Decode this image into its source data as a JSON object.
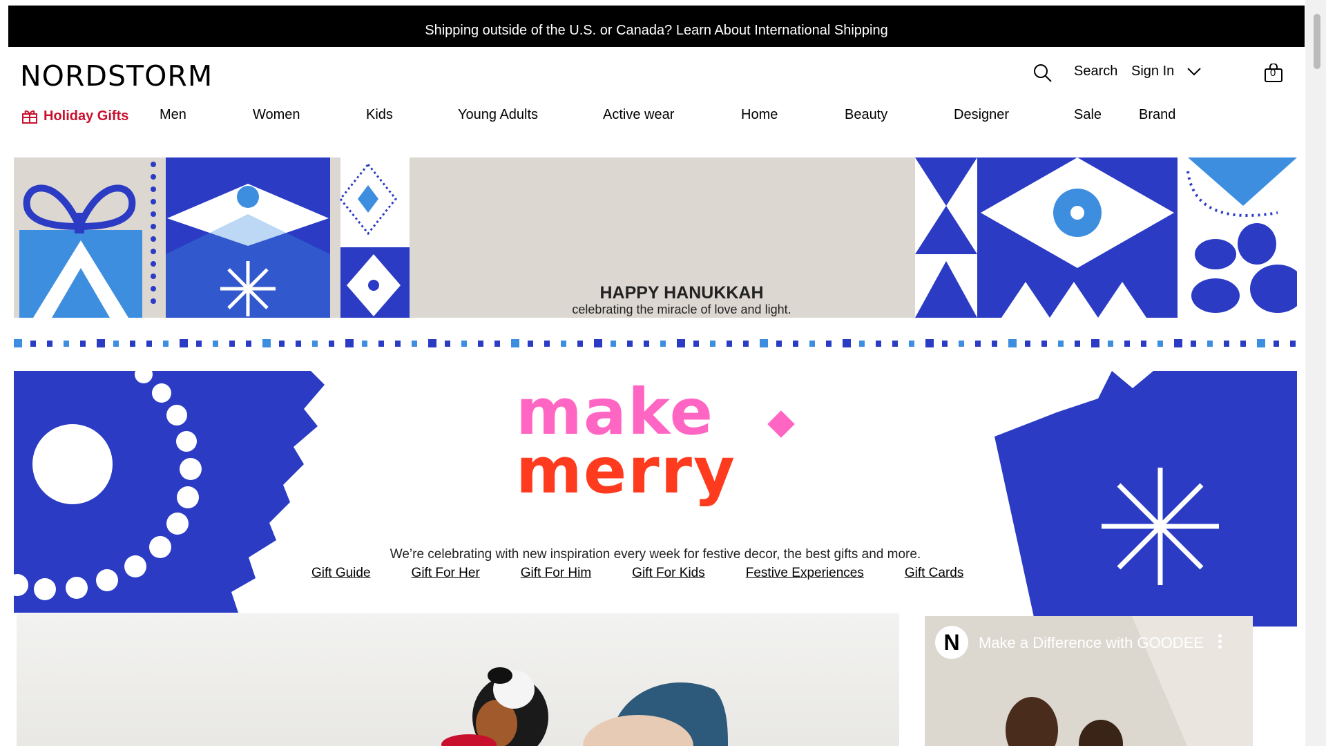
{
  "announcement": "Shipping outside of the U.S. or Canada? Learn About International Shipping",
  "brand": "NORDSTORM",
  "header": {
    "search_label": "Search",
    "signin_label": "Sign In",
    "bag_count": "0"
  },
  "nav": {
    "holiday": "Holiday Gifts",
    "items": [
      "Men",
      "Women",
      "Kids",
      "Young Adults",
      "Active wear",
      "Home",
      "Beauty",
      "Designer",
      "Sale",
      "Brand"
    ]
  },
  "hanukkah": {
    "title": "HAPPY HANUKKAH",
    "subtitle": "celebrating the miracle of love and light."
  },
  "merry": {
    "line1": "make",
    "line2": "merry",
    "description": "We’re celebrating with new inspiration every week for festive decor, the best gifts and more.",
    "links": [
      "Gift Guide",
      "Gift For Her",
      "Gift For Him",
      "Gift For Kids",
      "Festive Experiences",
      "Gift Cards"
    ]
  },
  "video": {
    "channel_initial": "N",
    "title": "Make a Difference with GOODEE"
  },
  "colors": {
    "accent_red": "#c8102e",
    "royal_blue": "#2b3bc4",
    "light_blue": "#3e8ee0",
    "pink": "#ff66c4",
    "orange_red": "#ff3b1f"
  }
}
